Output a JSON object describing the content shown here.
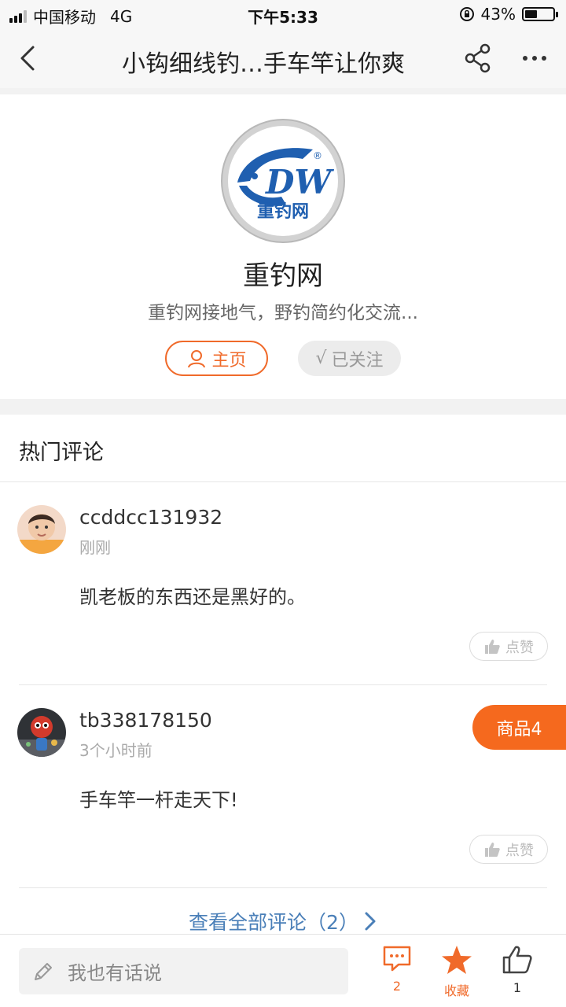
{
  "status_bar": {
    "carrier": "中国移动",
    "network": "4G",
    "time": "下午5:33",
    "battery": "43%",
    "battery_level": 0.43
  },
  "nav": {
    "title": "小钩细线钓…手车竿让你爽"
  },
  "profile": {
    "logo_text": "DW",
    "logo_subtext": "重钓网",
    "logo_mark": "®",
    "name": "重钓网",
    "description": "重钓网接地气，野钓简约化交流...",
    "home_label": "主页",
    "follow_label": "已关注",
    "follow_check": "√"
  },
  "comments": {
    "title": "热门评论",
    "items": [
      {
        "user": "ccddcc131932",
        "time": "刚刚",
        "text": "凯老板的东西还是黑好的。",
        "like_label": "点赞"
      },
      {
        "user": "tb338178150",
        "time": "3个小时前",
        "text": "手车竿一杆走天下!",
        "like_label": "点赞"
      }
    ],
    "view_all": "查看全部评论（2）"
  },
  "goods_tab": {
    "label": "商品4"
  },
  "bottom_bar": {
    "input_placeholder": "我也有话说",
    "comment_count": "2",
    "favorite_label": "收藏",
    "like_count": "1"
  },
  "colors": {
    "accent": "#f06a2a",
    "link": "#4a7fb8",
    "goods": "#f5691e"
  }
}
